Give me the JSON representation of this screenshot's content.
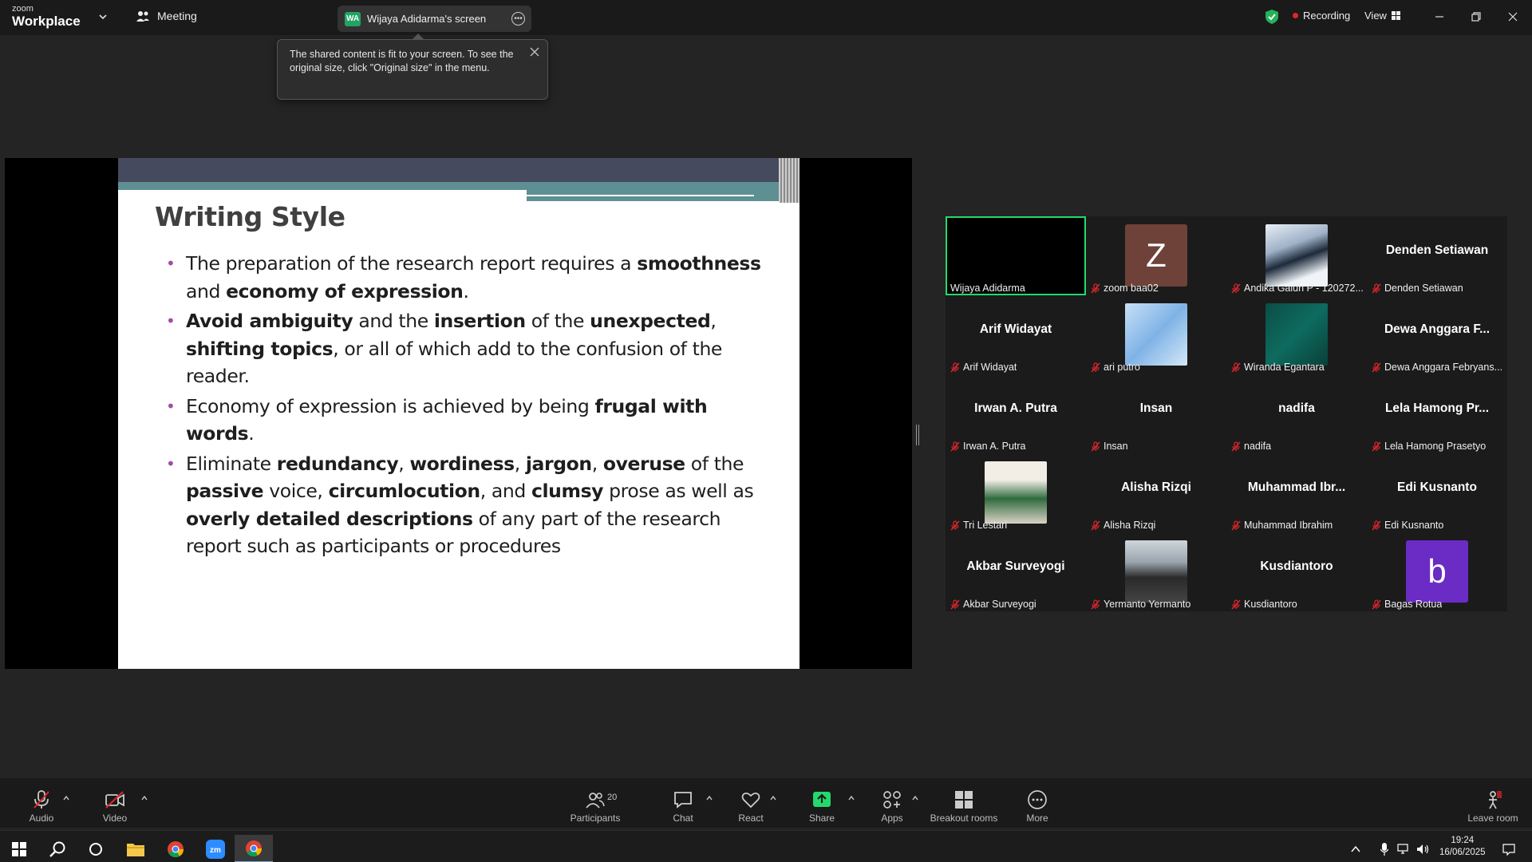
{
  "titlebar": {
    "brand_small": "zoom",
    "brand_big": "Workplace",
    "meeting_label": "Meeting",
    "share_tab_badge": "WA",
    "share_tab_label": "Wijaya Adidarma's screen",
    "recording_label": "Recording",
    "view_label": "View"
  },
  "tooltip": {
    "text": "The shared content is fit to your screen. To see the original size, click \"Original size\" in the menu."
  },
  "slide": {
    "title": "Writing Style"
  },
  "gallery": {
    "tiles": [
      {
        "label": "Wijaya Adidarma",
        "bigname": ""
      },
      {
        "label": "zoom baa02",
        "bigname": "",
        "letter": "Z"
      },
      {
        "label": "Andika Galuh P - 120272...",
        "bigname": ""
      },
      {
        "label": "Denden Setiawan",
        "bigname": "Denden Setiawan"
      },
      {
        "label": "Arif Widayat",
        "bigname": "Arif Widayat"
      },
      {
        "label": "ari putro",
        "bigname": ""
      },
      {
        "label": "Wiranda Egantara",
        "bigname": ""
      },
      {
        "label": "Dewa Anggara Febryans...",
        "bigname": "Dewa Anggara F..."
      },
      {
        "label": "Irwan A. Putra",
        "bigname": "Irwan A. Putra"
      },
      {
        "label": "Insan",
        "bigname": "Insan"
      },
      {
        "label": "nadifa",
        "bigname": "nadifa"
      },
      {
        "label": "Lela Hamong Prasetyo",
        "bigname": "Lela Hamong Pr..."
      },
      {
        "label": "Tri Lestari",
        "bigname": ""
      },
      {
        "label": "Alisha Rizqi",
        "bigname": "Alisha Rizqi"
      },
      {
        "label": "Muhammad Ibrahim",
        "bigname": "Muhammad Ibr..."
      },
      {
        "label": "Edi Kusnanto",
        "bigname": "Edi Kusnanto"
      },
      {
        "label": "Akbar Surveyogi",
        "bigname": "Akbar Surveyogi"
      },
      {
        "label": "Yermanto Yermanto",
        "bigname": ""
      },
      {
        "label": "Kusdiantoro",
        "bigname": "Kusdiantoro"
      },
      {
        "label": "Bagas Rotua",
        "bigname": "",
        "letter": "b"
      }
    ]
  },
  "toolbar": {
    "audio": "Audio",
    "video": "Video",
    "participants": "Participants",
    "participants_count": "20",
    "chat": "Chat",
    "react": "React",
    "share": "Share",
    "apps": "Apps",
    "breakout": "Breakout rooms",
    "more": "More",
    "leave": "Leave room"
  },
  "taskbar": {
    "time": "19:24",
    "date": "16/06/2025"
  },
  "colors": {
    "accent_green": "#23d96e",
    "record_red": "#e0262c",
    "share_green": "#23d96e",
    "bullet_purple": "#a14ca6"
  }
}
